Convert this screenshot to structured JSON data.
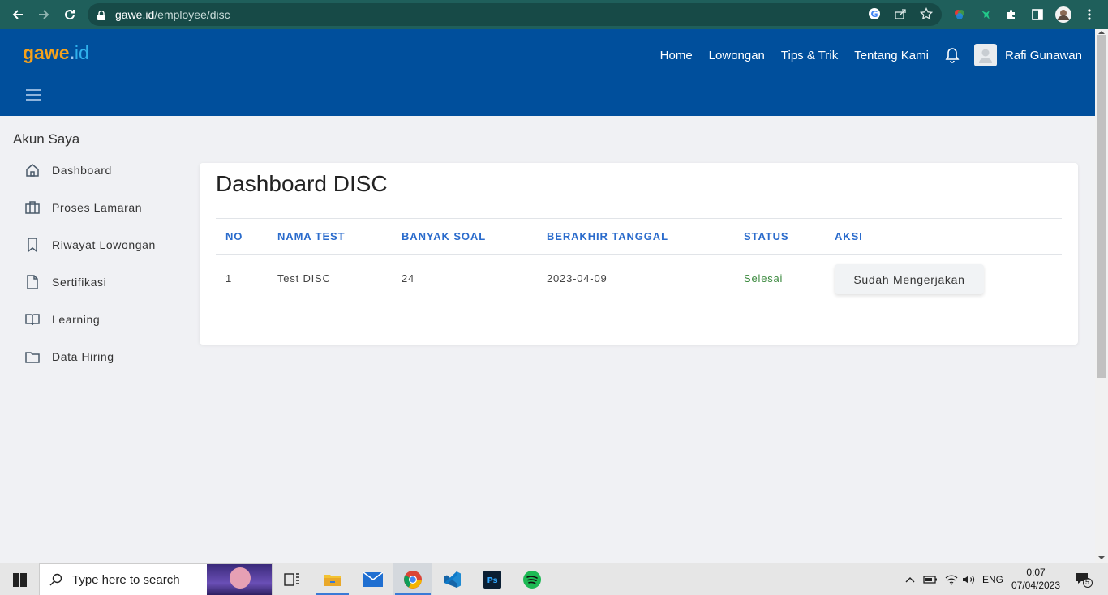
{
  "browser": {
    "url_host": "gawe.id",
    "url_path": "/employee/disc"
  },
  "site": {
    "logo": {
      "part1": "gawe",
      "part2": ".",
      "part3": "id"
    },
    "nav": [
      "Home",
      "Lowongan",
      "Tips & Trik",
      "Tentang Kami"
    ],
    "username": "Rafi Gunawan",
    "brand_color": "#004f9c"
  },
  "sidebar": {
    "title": "Akun Saya",
    "items": [
      {
        "label": "Dashboard",
        "icon": "home-icon"
      },
      {
        "label": "Proses Lamaran",
        "icon": "briefcase-icon"
      },
      {
        "label": "Riwayat Lowongan",
        "icon": "bookmark-icon"
      },
      {
        "label": "Sertifikasi",
        "icon": "file-icon"
      },
      {
        "label": "Learning",
        "icon": "book-icon"
      },
      {
        "label": "Data Hiring",
        "icon": "folder-icon"
      }
    ]
  },
  "main": {
    "title": "Dashboard DISC",
    "table": {
      "headers": [
        "NO",
        "NAMA TEST",
        "BANYAK SOAL",
        "BERAKHIR TANGGAL",
        "STATUS",
        "AKSI"
      ],
      "rows": [
        {
          "no": "1",
          "name": "Test DISC",
          "questions": "24",
          "end_date": "2023-04-09",
          "status": "Selesai",
          "action": "Sudah Mengerjakan"
        }
      ]
    }
  },
  "taskbar": {
    "search_placeholder": "Type here to search",
    "language": "ENG",
    "time": "0:07",
    "date": "07/04/2023",
    "notifications": "5"
  }
}
